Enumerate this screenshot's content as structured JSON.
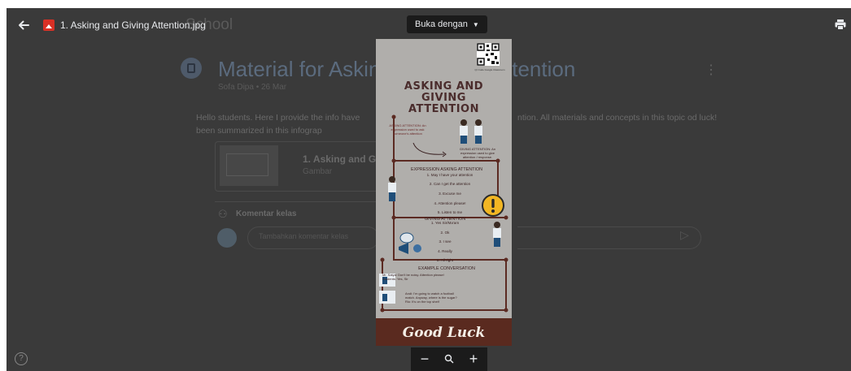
{
  "viewer": {
    "file_name": "1. Asking and Giving Attention.jpg",
    "open_with_label": "Buka dengan"
  },
  "background": {
    "brand": "School",
    "title_left": "Material for Askin",
    "title_right": "ttention",
    "meta": "Sofa Dipa • 26 Mar",
    "description_left": "Hello students. Here I provide the info have been summarized in this infograp",
    "description_right": "ntion. All materials and concepts in this topic od luck!",
    "attachment_title": "1. Asking and Gi",
    "attachment_type": "Gambar",
    "comments_label": "Komentar kelas",
    "comment_placeholder": "Tambahkan komentar kelas"
  },
  "infographic": {
    "qr_caption": "Qr Code Google Classroom",
    "title_line1": "ASKING AND GIVING",
    "title_line2": "ATTENTION",
    "asking_def_1": "ASKING ATTENTION: An",
    "asking_def_2": "expression used to ask",
    "asking_def_3": "someone's attention",
    "giving_def_1": "GIVING ATTENTION: An",
    "giving_def_2": "expression used to give",
    "giving_def_3": "attention / response.",
    "expr_asking_heading": "EXPRESSION ASKING ATTENTION",
    "asking_items": [
      "1. May I have your attention",
      "2. Can I get the attention",
      "3. Excuse me",
      "4. Attention please!",
      "5. Listen to me"
    ],
    "giving_heading": "GIVING ATTENTION",
    "giving_items": [
      "1. Yes Sir/Ma'am",
      "2. Ok",
      "3. I see",
      "4. Really",
      "5. All right"
    ],
    "example_heading": "EXAMPLE CONVERSATION",
    "conv_1a": "Mr. Satya: Don't be noisy. Attention please!",
    "conv_1b": "Students: Yes, Sir",
    "conv_2a": "Andi: I'm going to watch a football",
    "conv_2b": "match. Anyway, where is the sugar?",
    "conv_2c": "Rio: It's on the top shelf",
    "footer": "Good Luck"
  },
  "colors": {
    "overlay": "#3a3a3a",
    "infographic_bg": "#b0aeab",
    "footer_bg": "#5a2a1f",
    "file_icon": "#d93025",
    "toolbar_bg": "#1b1b1b"
  },
  "icons": {
    "back": "arrow-left-icon",
    "file": "image-file-icon",
    "dropdown": "caret-down-icon",
    "print": "printer-icon",
    "help": "help-circle-icon",
    "zoom_out": "minus-icon",
    "zoom_reset": "magnifier-icon",
    "zoom_in": "plus-icon"
  }
}
